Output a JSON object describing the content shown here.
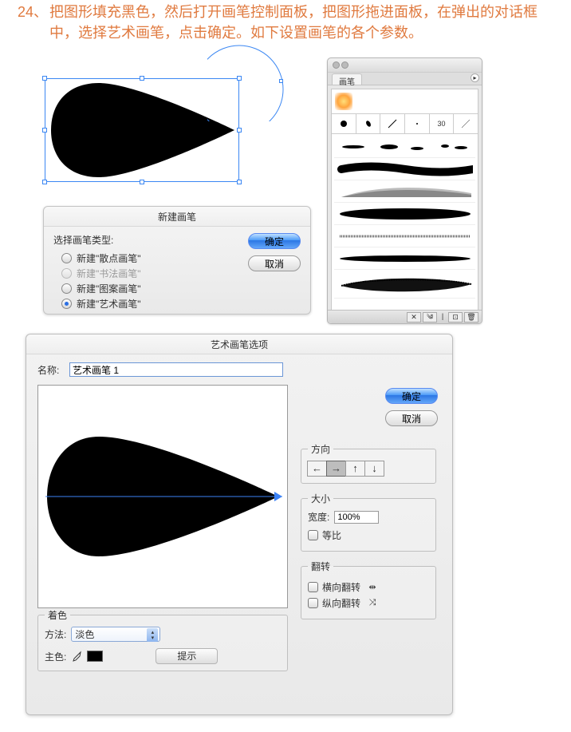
{
  "step": {
    "number": "24、",
    "text": "把图形填充黑色，然后打开画笔控制面板，把图形拖进面板，在弹出的对话框中，选择艺术画笔，点击确定。如下设置画笔的各个参数。"
  },
  "panel": {
    "tab": "画笔",
    "basic_cells": [
      "●",
      "/",
      "/",
      "·",
      "30",
      ""
    ],
    "footer_icons": [
      "✕",
      "✎",
      "▯",
      "⊡",
      "🗑"
    ]
  },
  "dlg_new": {
    "title": "新建画笔",
    "type_label": "选择画笔类型:",
    "options": {
      "scatter": "新建\"散点画笔\"",
      "calligraphic": "新建\"书法画笔\"",
      "pattern": "新建\"图案画笔\"",
      "art": "新建\"艺术画笔\""
    },
    "ok": "确定",
    "cancel": "取消"
  },
  "dlg_art": {
    "title": "艺术画笔选项",
    "name_label": "名称:",
    "name_value": "艺术画笔 1",
    "ok": "确定",
    "cancel": "取消",
    "direction": {
      "legend": "方向",
      "arrows": [
        "←",
        "→",
        "↑",
        "↓"
      ]
    },
    "size": {
      "legend": "大小",
      "width_label": "宽度:",
      "width_value": "100%",
      "proportional": "等比"
    },
    "flip": {
      "legend": "翻转",
      "horizontal": "横向翻转",
      "vertical": "纵向翻转"
    },
    "color": {
      "legend": "着色",
      "method_label": "方法:",
      "method_value": "淡色",
      "key_label": "主色:",
      "tip": "提示"
    }
  }
}
